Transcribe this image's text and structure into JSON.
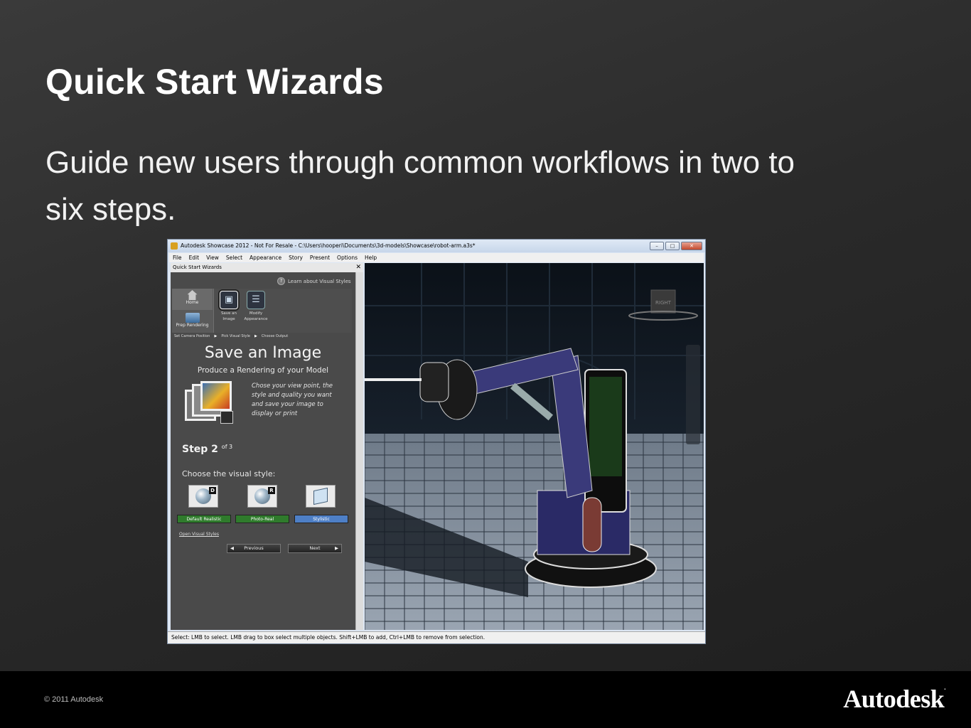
{
  "slide": {
    "title": "Quick Start Wizards",
    "subtitle": "Guide new users through common workflows in two to six steps.",
    "copyright": "© 2011 Autodesk",
    "logo": "Autodesk"
  },
  "window": {
    "title": "Autodesk Showcase 2012 - Not For Resale - C:\\Users\\hooperi\\Documents\\3d-models\\Showcase\\robot-arm.a3s*",
    "controls": {
      "minimize": "–",
      "maximize": "□",
      "close": "✕"
    },
    "menu": [
      "File",
      "Edit",
      "View",
      "Select",
      "Appearance",
      "Story",
      "Present",
      "Options",
      "Help"
    ]
  },
  "panel": {
    "header": "Quick Start Wizards",
    "close": "✕",
    "learn": "Learn about Visual Styles",
    "help": "?",
    "tabs": {
      "home": "Home",
      "prep": "Prep Rendering"
    },
    "buttons": {
      "save": "Save an Image",
      "modify": "Modify Appearance"
    },
    "crumbs": [
      "Set Camera Position",
      "Pick Visual Style",
      "Choose Output"
    ],
    "title": "Save an Image",
    "subtitle": "Produce a Rendering of your Model",
    "description": "Chose your view point, the style and quality you want and save your image to display or print",
    "step_label": "Step 2",
    "step_of": "of 3",
    "choose_label": "Choose the visual style:",
    "styles": [
      {
        "label": "Default Realistic",
        "badge": "D"
      },
      {
        "label": "Photo-Real",
        "badge": "R"
      },
      {
        "label": "Stylistic",
        "badge": ""
      }
    ],
    "open_link": "Open Visual Styles",
    "previous": "Previous",
    "next": "Next"
  },
  "viewport": {
    "view_cube_label": "RIGHT"
  },
  "status": "Select: LMB to select. LMB drag to box select multiple objects. Shift+LMB to add, Ctrl+LMB to remove from selection.",
  "colors": {
    "accent_green": "#2f7b2c",
    "accent_blue": "#4e7fc6",
    "robot": "#3a3a7a"
  }
}
